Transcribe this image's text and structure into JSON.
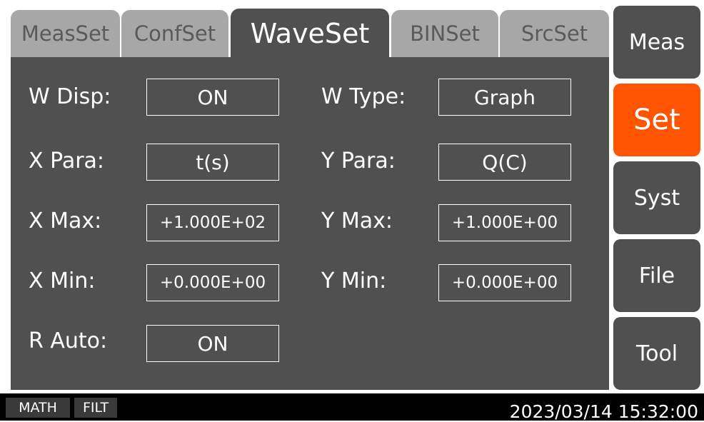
{
  "tabs": [
    {
      "label": "MeasSet",
      "active": false
    },
    {
      "label": "ConfSet",
      "active": false
    },
    {
      "label": "WaveSet",
      "active": true
    },
    {
      "label": "BINSet",
      "active": false
    },
    {
      "label": "SrcSet",
      "active": false
    }
  ],
  "settings": {
    "w_disp": {
      "label": "W Disp:",
      "value": "ON"
    },
    "w_type": {
      "label": "W Type:",
      "value": "Graph"
    },
    "x_para": {
      "label": "X Para:",
      "value": "t(s)"
    },
    "y_para": {
      "label": "Y Para:",
      "value": "Q(C)"
    },
    "x_max": {
      "label": "X Max:",
      "value": "+1.000E+02"
    },
    "y_max": {
      "label": "Y Max:",
      "value": "+1.000E+00"
    },
    "x_min": {
      "label": "X Min:",
      "value": "+0.000E+00"
    },
    "y_min": {
      "label": "Y Min:",
      "value": "+0.000E+00"
    },
    "r_auto": {
      "label": "R Auto:",
      "value": "ON"
    }
  },
  "side_menu": [
    {
      "label": "Meas",
      "active": false
    },
    {
      "label": "Set",
      "active": true
    },
    {
      "label": "Syst",
      "active": false
    },
    {
      "label": "File",
      "active": false
    },
    {
      "label": "Tool",
      "active": false
    }
  ],
  "status_bar": {
    "flags": [
      "MATH",
      "FILT"
    ],
    "datetime": "2023/03/14 15:32:00"
  },
  "colors": {
    "panel": "#505050",
    "tab_inactive": "#a7a7a7",
    "accent": "#ff5500",
    "status_bar": "#000000"
  }
}
